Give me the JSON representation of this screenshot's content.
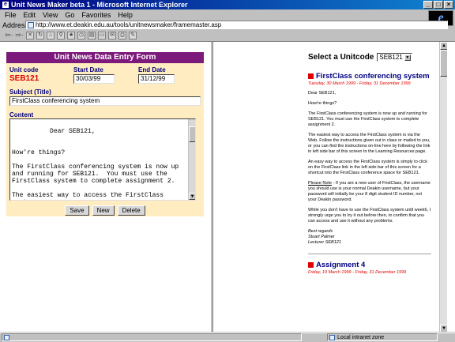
{
  "window": {
    "title": "Unit News Maker beta 1 - Microsoft Internet Explorer",
    "ie_logo": "e"
  },
  "menu": [
    "File",
    "Edit",
    "View",
    "Go",
    "Favorites",
    "Help"
  ],
  "address": {
    "label": "Address",
    "url": "http://www.et.deakin.edu.au/tools/unitnewsmaker/framemaster.asp"
  },
  "form": {
    "heading": "Unit News Data Entry Form",
    "unit_code_label": "Unit code",
    "unit_code": "SEB121",
    "start_label": "Start Date",
    "start_value": "30/03/99",
    "end_label": "End Date",
    "end_value": "31/12/99",
    "subject_label": "Subject (Title)",
    "subject_value": "FirstClass conferencing system",
    "content_label": "Content",
    "content_value": "Dear SEB121,\n\n\nHow're things?\n\nThe FirstClass conferencing system is now up and running for SEB121.  You must use the FirstClass system to complete assignment 2.\n\nThe easiest way to access the FirstClass system",
    "buttons": {
      "save": "Save",
      "new": "New",
      "delete": "Delete"
    }
  },
  "right": {
    "select_label": "Select a Unitcode",
    "select_value": "SEB121",
    "item1": {
      "title": "FirstClass conferencing system",
      "date": "Tuesday, 30 March 1999 - Friday, 31 December 1999",
      "greeting": "Dear SEB121,",
      "p1": "How're things?",
      "p2": "The FirstClass conferencing system is now up and running for SEB121. You must use the FirstClass system to complete assignment 2.",
      "p3": "The easiest way to access the FirstClass system is via the Web. Follow the instructions given out in class or mailed to you, or you can find the instructions on-line here by following the link in left side bar of this screen to the Learning Resources page.",
      "p4": "An easy way to access the FirstClass system is simply to click on the FirstClass link in the left side bar of this screen for a shortcut into the FirstClass conference space for SEB121.",
      "p5_lead": "Please Note",
      "p5": " - If you are a new user of FirstClass, the username you should use is your normal Deakin username, but your password will initially be your 8 digit student ID number, not your Deakin password.",
      "p6": "While you don't have to use the FirstClass system until week6, I strongly urge you to try it out before then, to confirm that you can access and use it without any problems.",
      "sig1": "Best regards",
      "sig2": "Stuart Palmer",
      "sig3": "Lecturer SEB121"
    },
    "item2": {
      "title": "Assignment 4",
      "date": "Friday, 19 March 1999 - Friday, 31 December 1999"
    }
  },
  "status": {
    "zone": "Local intranet zone"
  }
}
